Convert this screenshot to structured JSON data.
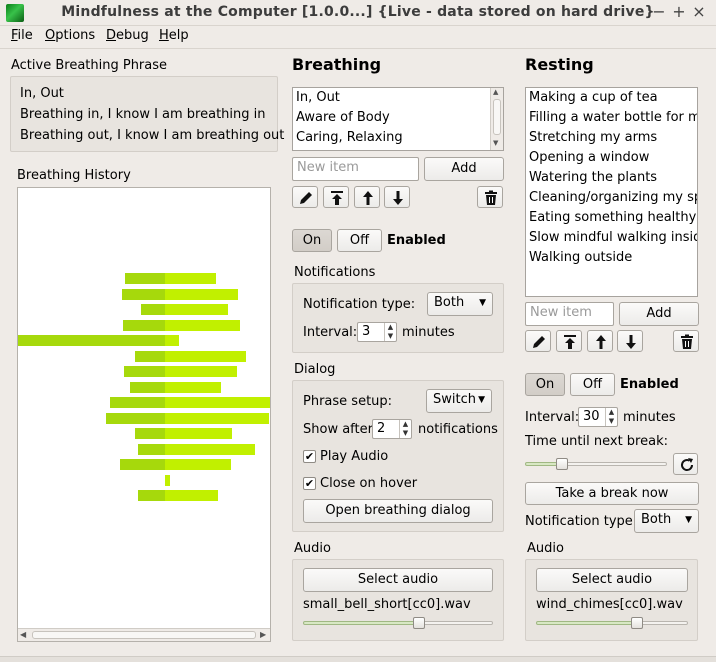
{
  "window": {
    "title": "Mindfulness at the Computer [1.0.0...] {Live - data stored on hard drive}",
    "controls": [
      "−",
      "+",
      "×"
    ]
  },
  "menu": [
    {
      "accel": "F",
      "rest": "ile"
    },
    {
      "accel": "O",
      "rest": "ptions"
    },
    {
      "accel": "D",
      "rest": "ebug"
    },
    {
      "accel": "H",
      "rest": "elp"
    }
  ],
  "active_phrase": {
    "heading": "Active Breathing Phrase",
    "lines": [
      "In, Out",
      "Breathing in, I know I am breathing in",
      "Breathing out, I know I am breathing out"
    ]
  },
  "history": {
    "heading": "Breathing History",
    "chart_data": {
      "type": "bar",
      "title": "",
      "orientation": "horizontal-diverging",
      "note_colors": {
        "in": "#a6d90c",
        "out": "#c1f000"
      },
      "rows": [
        {
          "in": 40,
          "out": 51
        },
        {
          "in": 43,
          "out": 73
        },
        {
          "in": 24,
          "out": 63
        },
        {
          "in": 42,
          "out": 75
        },
        {
          "in": 147,
          "out": 14
        },
        {
          "in": 30,
          "out": 81
        },
        {
          "in": 41,
          "out": 72
        },
        {
          "in": 35,
          "out": 56
        },
        {
          "in": 55,
          "out": 105
        },
        {
          "in": 59,
          "out": 104
        },
        {
          "in": 30,
          "out": 67
        },
        {
          "in": 27,
          "out": 90
        },
        {
          "in": 45,
          "out": 66
        },
        {
          "in": 0,
          "out": 5
        },
        {
          "in": 27,
          "out": 53
        }
      ]
    }
  },
  "breathing": {
    "heading": "Breathing",
    "phrases": [
      "In, Out",
      "Aware of Body",
      "Caring, Relaxing"
    ],
    "new_item_placeholder": "New item",
    "add_label": "Add",
    "on_label": "On",
    "off_label": "Off",
    "state_label": "Enabled",
    "notifications": {
      "heading": "Notifications",
      "type_label": "Notification type:",
      "type_value": "Both",
      "interval_label": "Interval:",
      "interval_value": "3",
      "interval_unit": "minutes"
    },
    "dialog": {
      "heading": "Dialog",
      "phrase_setup_label": "Phrase setup:",
      "phrase_setup_value": "Switch",
      "show_after_label": "Show after",
      "show_after_value": "2",
      "show_after_unit": "notifications",
      "play_audio_label": "Play Audio",
      "play_audio_checked": true,
      "close_hover_label": "Close on hover",
      "close_hover_checked": true,
      "open_dialog_label": "Open breathing dialog"
    },
    "audio": {
      "heading": "Audio",
      "select_label": "Select audio",
      "file": "small_bell_short[cc0].wav",
      "volume": 0.62
    }
  },
  "resting": {
    "heading": "Resting",
    "activities": [
      "Making a cup of tea",
      "Filling a water bottle for my desk",
      "Stretching my arms",
      "Opening a window",
      "Watering the plants",
      "Cleaning/organizing my space",
      "Eating something healthy",
      "Slow mindful walking inside",
      "Walking outside"
    ],
    "new_item_placeholder": "New item",
    "add_label": "Add",
    "on_label": "On",
    "off_label": "Off",
    "state_label": "Enabled",
    "interval_label": "Interval:",
    "interval_value": "30",
    "interval_unit": "minutes",
    "time_until_label": "Time until next break:",
    "time_until_progress": 0.24,
    "take_break_label": "Take a break now",
    "notification_type_label": "Notification type:",
    "notification_type_value": "Both",
    "audio": {
      "heading": "Audio",
      "select_label": "Select audio",
      "file": "wind_chimes[cc0].wav",
      "volume": 0.68
    }
  }
}
